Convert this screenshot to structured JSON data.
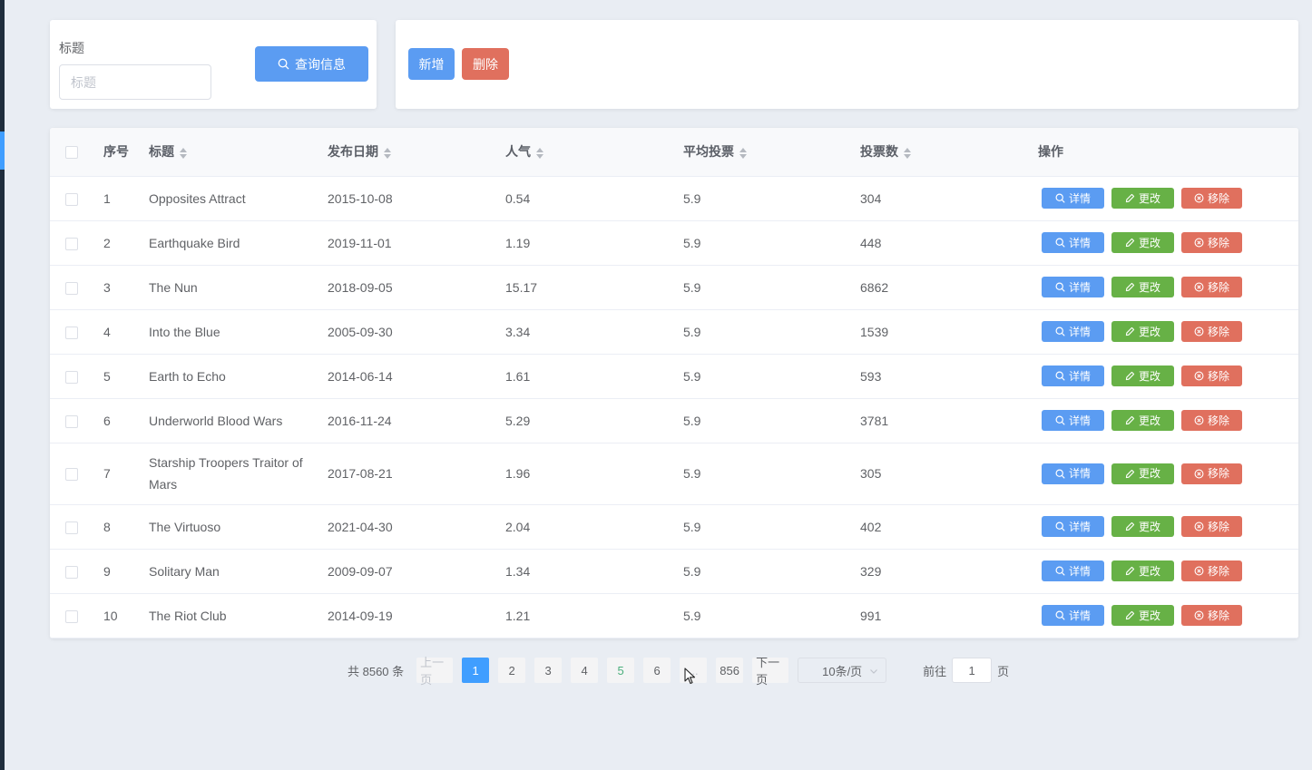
{
  "search": {
    "label": "标题",
    "placeholder": "标题",
    "button_label": "查询信息"
  },
  "actions": {
    "add_label": "新增",
    "delete_label": "删除"
  },
  "table": {
    "columns": {
      "index": "序号",
      "title": "标题",
      "release_date": "发布日期",
      "popularity": "人气",
      "avg_vote": "平均投票",
      "vote_count": "投票数",
      "operations": "操作"
    },
    "row_buttons": {
      "detail": "详情",
      "edit": "更改",
      "remove": "移除"
    },
    "rows": [
      {
        "index": "1",
        "title": "Opposites Attract",
        "release_date": "2015-10-08",
        "popularity": "0.54",
        "avg_vote": "5.9",
        "vote_count": "304"
      },
      {
        "index": "2",
        "title": "Earthquake Bird",
        "release_date": "2019-11-01",
        "popularity": "1.19",
        "avg_vote": "5.9",
        "vote_count": "448"
      },
      {
        "index": "3",
        "title": "The Nun",
        "release_date": "2018-09-05",
        "popularity": "15.17",
        "avg_vote": "5.9",
        "vote_count": "6862"
      },
      {
        "index": "4",
        "title": "Into the Blue",
        "release_date": "2005-09-30",
        "popularity": "3.34",
        "avg_vote": "5.9",
        "vote_count": "1539"
      },
      {
        "index": "5",
        "title": "Earth to Echo",
        "release_date": "2014-06-14",
        "popularity": "1.61",
        "avg_vote": "5.9",
        "vote_count": "593"
      },
      {
        "index": "6",
        "title": "Underworld Blood Wars",
        "release_date": "2016-11-24",
        "popularity": "5.29",
        "avg_vote": "5.9",
        "vote_count": "3781"
      },
      {
        "index": "7",
        "title": "Starship Troopers Traitor of Mars",
        "release_date": "2017-08-21",
        "popularity": "1.96",
        "avg_vote": "5.9",
        "vote_count": "305"
      },
      {
        "index": "8",
        "title": "The Virtuoso",
        "release_date": "2021-04-30",
        "popularity": "2.04",
        "avg_vote": "5.9",
        "vote_count": "402"
      },
      {
        "index": "9",
        "title": "Solitary Man",
        "release_date": "2009-09-07",
        "popularity": "1.34",
        "avg_vote": "5.9",
        "vote_count": "329"
      },
      {
        "index": "10",
        "title": "The Riot Club",
        "release_date": "2014-09-19",
        "popularity": "1.21",
        "avg_vote": "5.9",
        "vote_count": "991"
      }
    ]
  },
  "pagination": {
    "total_label": "共 8560 条",
    "prev_label": "上一页",
    "next_label": "下一页",
    "pages": [
      "1",
      "2",
      "3",
      "4",
      "5",
      "6"
    ],
    "ellipsis": "...",
    "last_page": "856",
    "current_page": "1",
    "page_size_label": "10条/页",
    "jump_prefix": "前往",
    "jump_value": "1",
    "jump_suffix": "页"
  },
  "colors": {
    "primary": "#5b9cf2",
    "success": "#67b146",
    "danger": "#e0705e",
    "background": "#e9edf3"
  }
}
